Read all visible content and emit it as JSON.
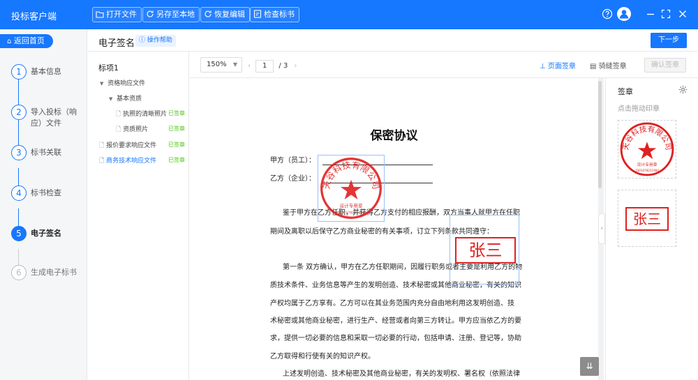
{
  "app": {
    "title": "投标客户端"
  },
  "toolbar": [
    {
      "label": "打开文件",
      "icon": "folder-icon"
    },
    {
      "label": "另存至本地",
      "icon": "refresh-icon"
    },
    {
      "label": "恢复编辑",
      "icon": "refresh-icon"
    },
    {
      "label": "检查标书",
      "icon": "document-check-icon"
    }
  ],
  "window_controls": [
    "help-icon",
    "user-avatar",
    "minimize-icon",
    "fullscreen-icon",
    "close-icon"
  ],
  "sidebar": {
    "back_label": "返回首页",
    "steps": [
      {
        "num": "1",
        "label": "基本信息",
        "state": "done"
      },
      {
        "num": "2",
        "label": "导入投标（响应）文件",
        "state": "done"
      },
      {
        "num": "3",
        "label": "标书关联",
        "state": "done"
      },
      {
        "num": "4",
        "label": "标书检查",
        "state": "done"
      },
      {
        "num": "5",
        "label": "电子签名",
        "state": "active"
      },
      {
        "num": "6",
        "label": "生成电子标书",
        "state": "pending"
      }
    ]
  },
  "header": {
    "title": "电子签名",
    "help": "操作帮助",
    "next": "下一步"
  },
  "tree": {
    "root": "标项1",
    "items": [
      {
        "label": "资格响应文件",
        "status": ""
      },
      {
        "label": "基本资质",
        "status": ""
      },
      {
        "label": "执照的清晰照片",
        "status": "已签章"
      },
      {
        "label": "资质照片",
        "status": "已签章"
      },
      {
        "label": "报价要求响应文件",
        "status": "已签章"
      },
      {
        "label": "商务技术响应文件",
        "status": "已签章"
      }
    ]
  },
  "doc_toolbar": {
    "zoom": "150%",
    "page_current": "1",
    "page_sep": "/",
    "page_total": "3",
    "page_sign": "页面签章",
    "seam_sign": "骑缝签章",
    "confirm": "确认签章"
  },
  "document": {
    "title": "保密协议",
    "party_a": "甲方（员工）：",
    "party_b": "乙方（企业）：",
    "p1_line1": "鉴于甲方在乙方任职，并获得乙方支付的相应报酬，双方当事人就甲方在任职",
    "p1_line2": "期间及离职以后保守乙方商业秘密的有关事项，订立下列条款共同遵守：",
    "p2_line1": "第一条  双方确认，甲方在乙方任职期间，因履行职务或者主要是利用乙方的物",
    "p2_line2": "质技术条件、业务信息等产生的发明创造、技术秘密或其他商业秘密，有关的知识",
    "p2_line3": "产权均属于乙方享有。乙方可以在其业务范围内充分自由地利用这发明创造、技",
    "p2_line4": "术秘密或其他商业秘密，进行生产、经营或者向第三方转让。甲方应当依乙方的要",
    "p2_line5": "求，提供一切必要的信息和采取一切必要的行动，包括申请、注册、登记等，协助",
    "p2_line6": "乙方取得和行使有关的知识产权。",
    "p3_line1": "上述发明创造、技术秘密及其他商业秘密，有关的发明权、署名权（依照法律"
  },
  "stamps": {
    "company_name": "天谷科技有限公司",
    "company_sub": "设计专用章",
    "company_code": "3301078221984",
    "signature": "张三"
  },
  "right_panel": {
    "title": "签章",
    "hint": "点击拖动印章"
  },
  "colors": {
    "primary": "#1677ff",
    "stamp_red": "#e02020",
    "signed_green": "#52c41a"
  }
}
